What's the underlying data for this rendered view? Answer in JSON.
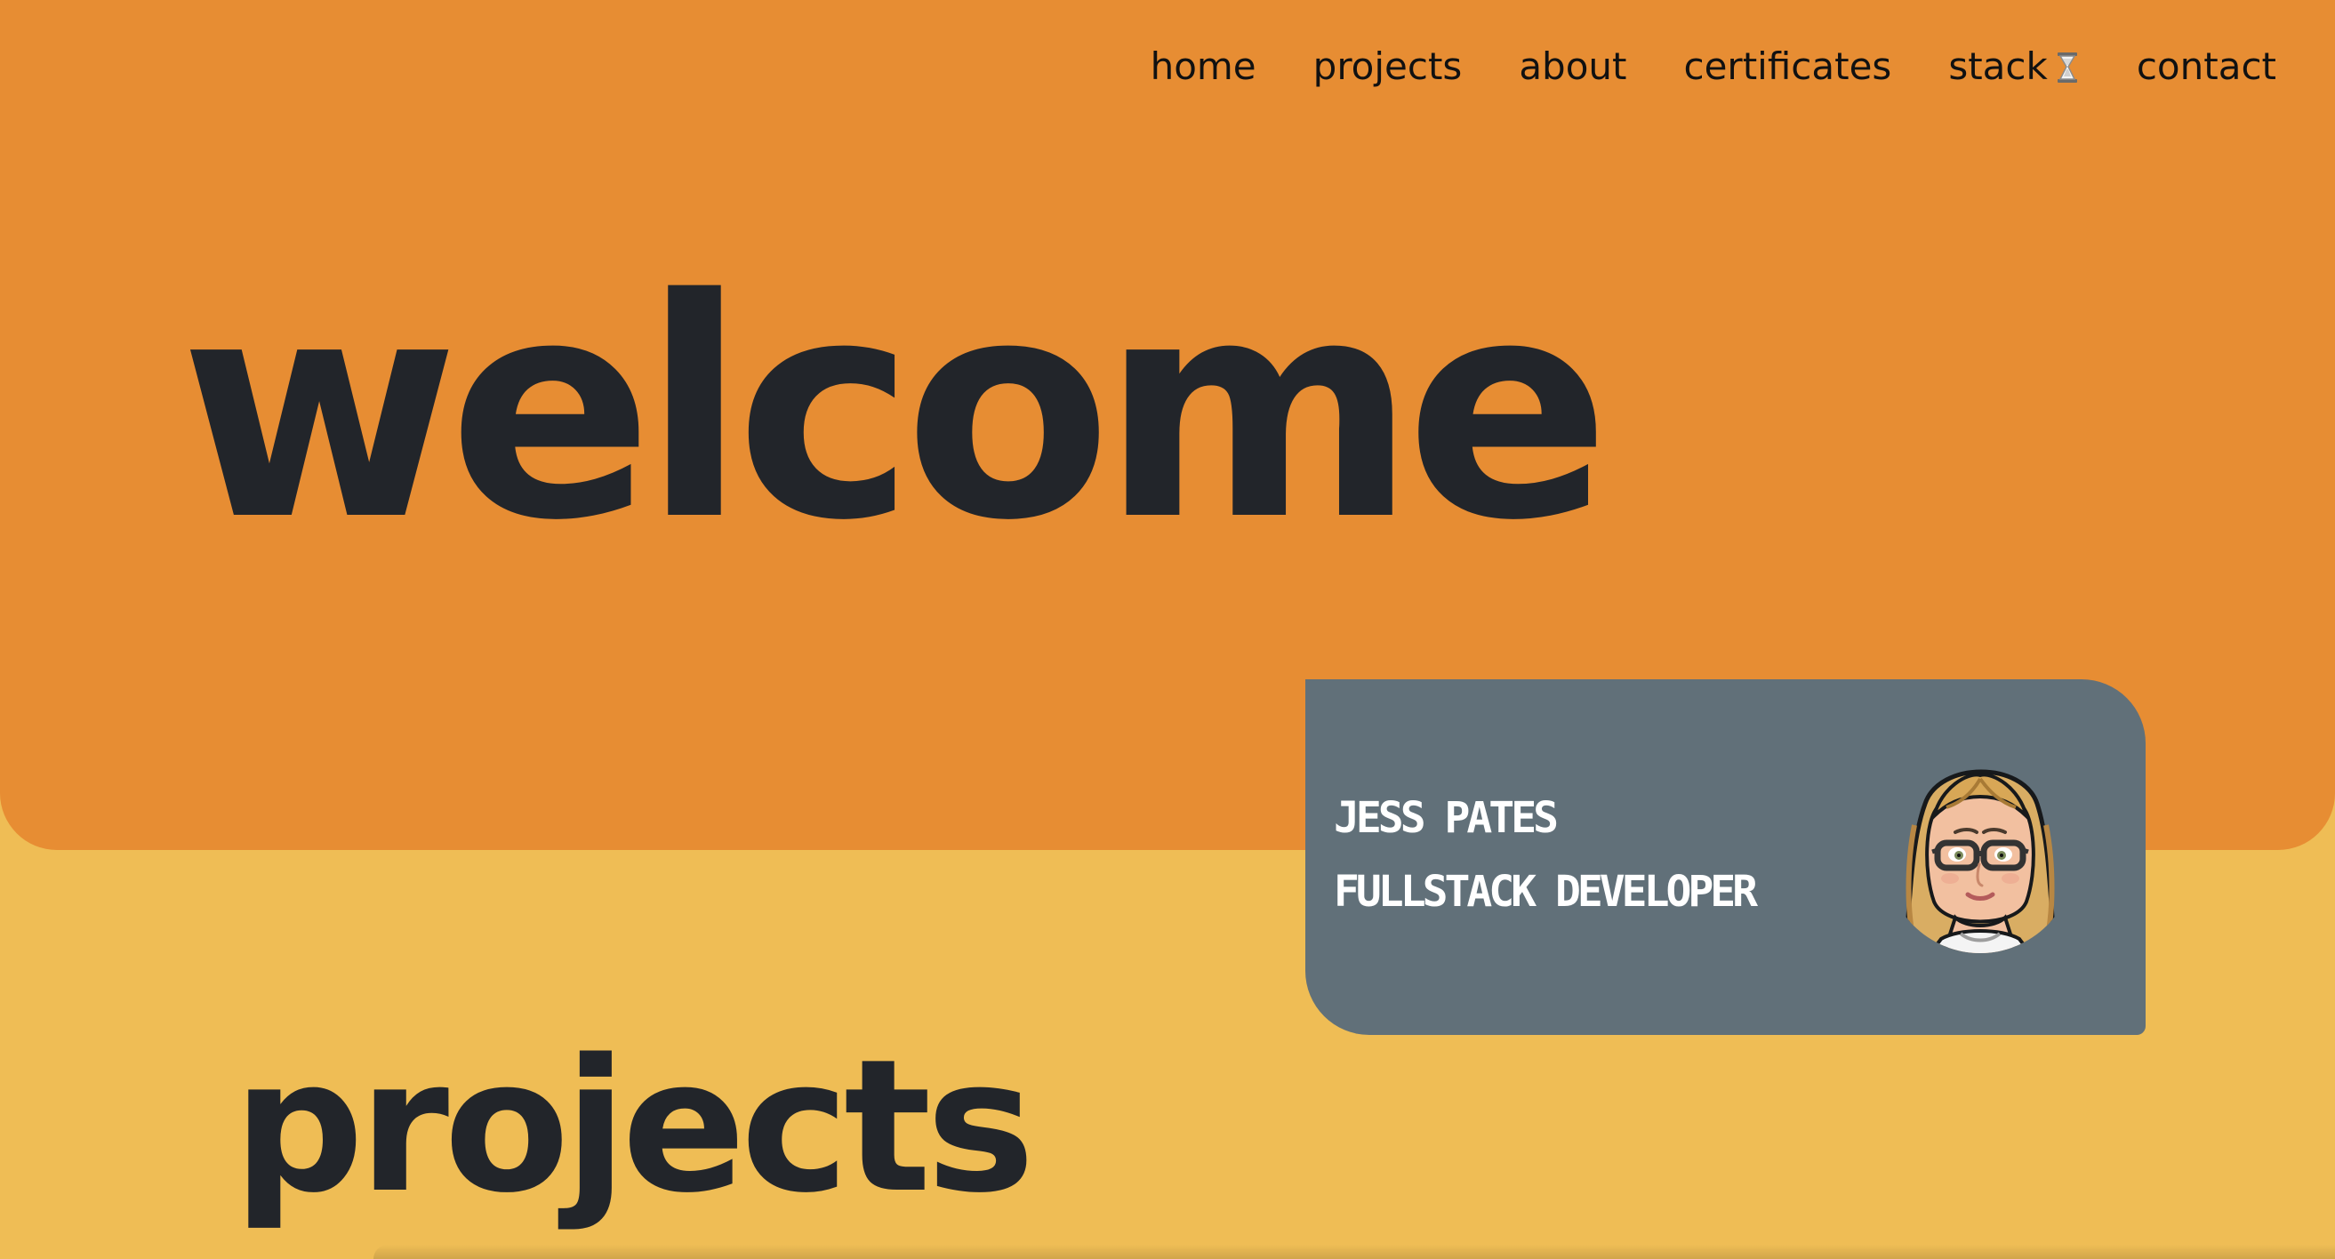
{
  "nav": {
    "items": [
      {
        "label": "home"
      },
      {
        "label": "projects"
      },
      {
        "label": "about"
      },
      {
        "label": "certificates"
      },
      {
        "label": "stack",
        "icon": "hourglass-icon"
      },
      {
        "label": "contact"
      }
    ]
  },
  "hero": {
    "title": "welcome"
  },
  "profile": {
    "name": "JESS PATES",
    "role": "FULLSTACK DEVELOPER",
    "avatar_icon": "avatar-icon"
  },
  "projects": {
    "title": "projects"
  },
  "colors": {
    "hero_background": "#e78d33",
    "page_background": "#efbd55",
    "card_background": "#617079",
    "text_dark": "#22252a",
    "text_light": "#ffffff"
  }
}
